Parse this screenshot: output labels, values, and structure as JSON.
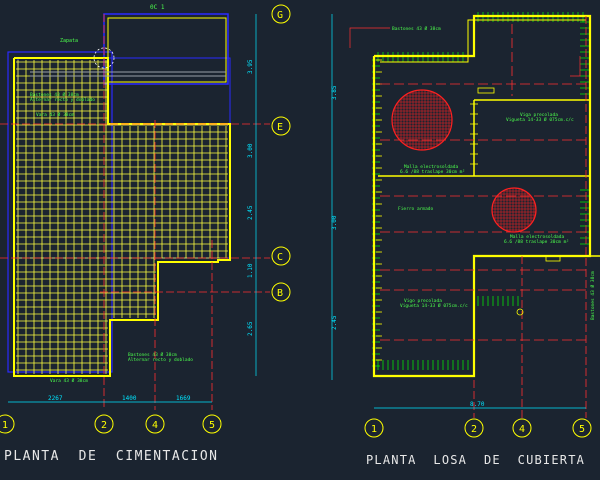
{
  "colors": {
    "background": "#1b2430",
    "walls": "#ffff00",
    "rebar": "#ffff40",
    "axis": "#ff3030",
    "hatch": "#ff2020",
    "dimension": "#00e5ff",
    "frame": "#2a2aff",
    "stirrups": "#00ff00",
    "bubble": "#ffff00",
    "title": "#e8e8e8",
    "annotation": "#4cff4c",
    "grey_line": "#9aa0a8"
  },
  "titles": {
    "cimentacion": "PLANTA  DE  CIMENTACION",
    "losa": "PLANTA  LOSA  DE  CUBIERTA"
  },
  "axes": {
    "left_x": [
      "1",
      "2",
      "4",
      "5"
    ],
    "right_x": [
      "1",
      "2",
      "4",
      "5"
    ],
    "y": [
      "G",
      "E",
      "C",
      "B"
    ]
  },
  "dimensions": {
    "left_bottom": [
      "2267",
      "1400",
      "1669"
    ],
    "right_bottom": "8.70",
    "left_vertical": [
      "3.95",
      "3.00",
      "2.45",
      "1.10",
      "2.65"
    ],
    "right_vertical": [
      "3.85",
      "3.00",
      "2.45"
    ]
  },
  "labels": {
    "cimentacion": {
      "header_top": "0C 1",
      "label_1": "Zapata",
      "label_2": "Bastones 43 Ø 38cm",
      "label_3": "Alternar recto y doblado",
      "label_4": "Vara 43 Ø 38cm",
      "label_5": "Bastones 43 Ø 38cm",
      "label_6": "Alternar recto y doblado",
      "label_7": "Vara 43 Ø 38cm"
    },
    "losa": {
      "label_1": "Bastones 43 Ø 38cm",
      "label_2": "Viga precolada",
      "label_3": "Vigueta 14-33 Ø 075cm.c/c",
      "label_4": "Malla electrosoldada",
      "label_5": "6.6 /88 traslape 30cm m²",
      "label_6": "Fierro armado",
      "label_7": "Malla electrosoldada",
      "label_8": "6.6 /88 traslape 30cm m²",
      "label_9": "Vigo precolada",
      "label_10": "Vigueta 14-33 Ø 075cm.c/c",
      "label_11": "Bastones 43 Ø 38cm"
    }
  }
}
